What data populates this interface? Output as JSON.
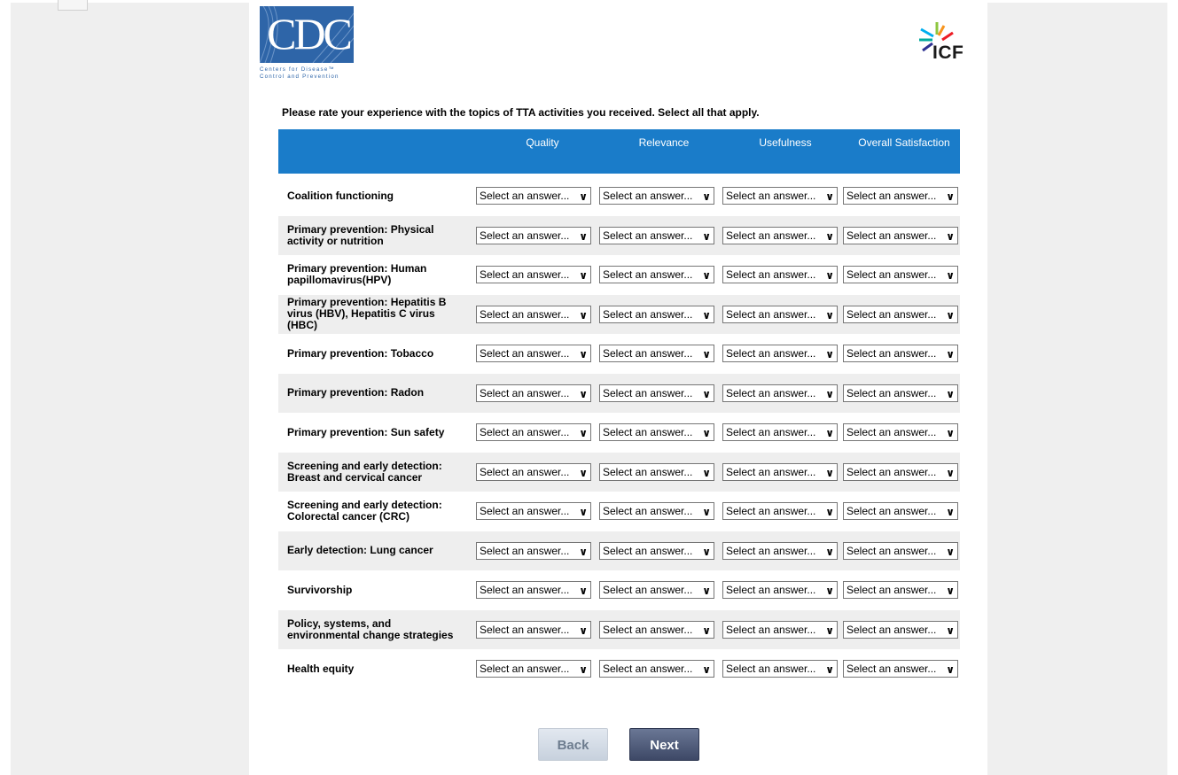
{
  "logos": {
    "cdc_letters": "CDC",
    "cdc_subtitle": "Centers for Disease™\nControl and Prevention",
    "icf_text": "ICF"
  },
  "question": "Please rate your experience with the topics of TTA activities you received. Select all that apply.",
  "columns": [
    "Quality",
    "Relevance",
    "Usefulness",
    "Overall Satisfaction"
  ],
  "select_placeholder": "Select an answer...",
  "rows": [
    {
      "label": "Coalition functioning"
    },
    {
      "label": "Primary prevention: Physical activity or nutrition"
    },
    {
      "label": "Primary prevention: Human papillomavirus(HPV)"
    },
    {
      "label": "Primary prevention: Hepatitis B virus (HBV), Hepatitis C virus (HBC)"
    },
    {
      "label": "Primary prevention: Tobacco"
    },
    {
      "label": "Primary prevention: Radon"
    },
    {
      "label": "Primary prevention: Sun safety"
    },
    {
      "label": "Screening and early detection: Breast and cervical cancer"
    },
    {
      "label": "Screening and early detection: Colorectal cancer (CRC)"
    },
    {
      "label": "Early detection: Lung cancer"
    },
    {
      "label": "Survivorship"
    },
    {
      "label": "Policy, systems, and environmental change strategies"
    },
    {
      "label": "Health equity"
    }
  ],
  "buttons": {
    "back": "Back",
    "next": "Next"
  },
  "colors": {
    "header_blue": "#1a7cc9",
    "cdc_blue": "#2e65a8",
    "next_button": "#4b5673",
    "back_button": "#d3dae4"
  }
}
